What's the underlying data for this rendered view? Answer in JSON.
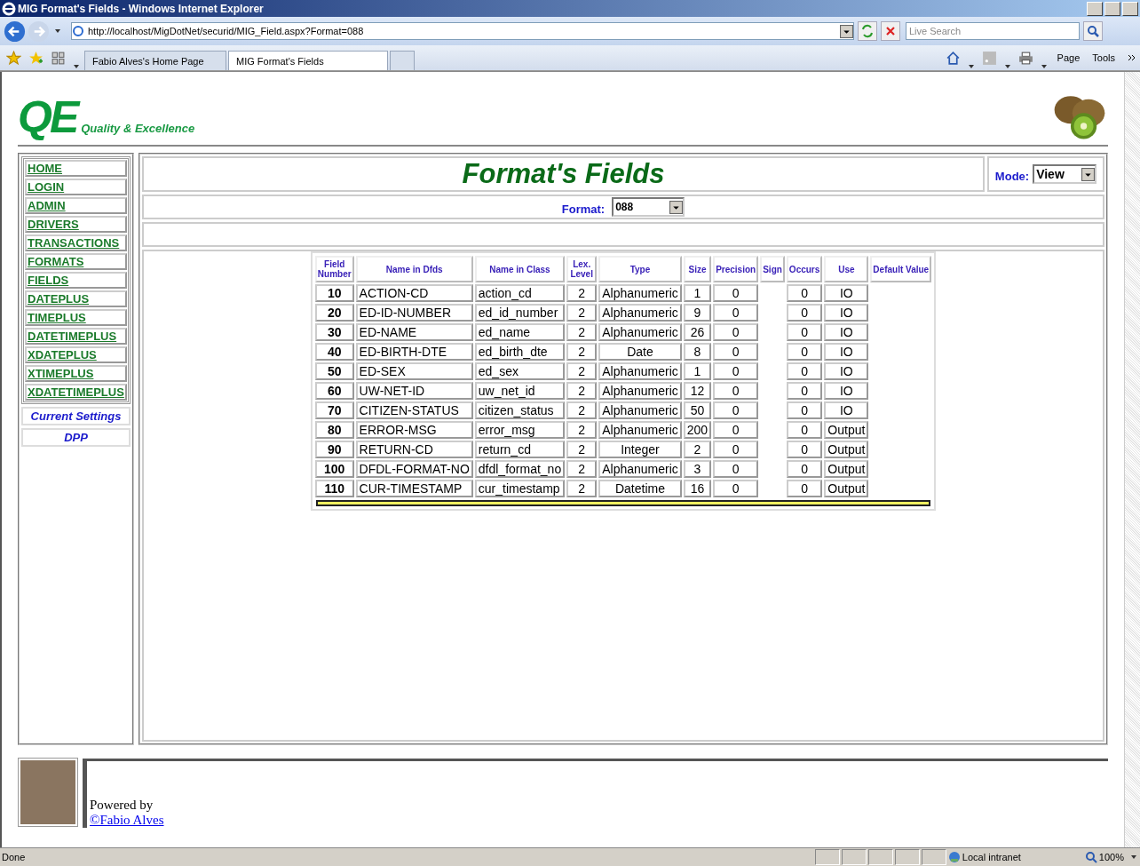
{
  "window": {
    "title": "MIG Format's Fields - Windows Internet Explorer"
  },
  "address": "http://localhost/MigDotNet/securid/MIG_Field.aspx?Format=088",
  "search": {
    "placeholder": "Live Search"
  },
  "tabs": [
    {
      "label": "Fabio Alves's Home Page",
      "selected": false
    },
    {
      "label": "MIG Format's Fields",
      "selected": true
    }
  ],
  "command_bar": [
    "Page",
    "Tools"
  ],
  "logo": {
    "mark": "QE",
    "tagline": "Quality & Excellence"
  },
  "nav": [
    "HOME",
    "LOGIN",
    "ADMIN",
    "DRIVERS",
    "TRANSACTIONS",
    "FORMATS",
    "FIELDS",
    "DATEPLUS",
    "TIMEPLUS",
    "DATETIMEPLUS",
    "XDATEPLUS",
    "XTIMEPLUS",
    "XDATETIMEPLUS"
  ],
  "side_links": [
    "Current Settings",
    "DPP"
  ],
  "heading": "Format's Fields",
  "mode": {
    "label": "Mode:",
    "value": "View"
  },
  "format": {
    "label": "Format:",
    "value": "088"
  },
  "table": {
    "columns": [
      "Field Number",
      "Name in Dfds",
      "Name in Class",
      "Lex. Level",
      "Type",
      "Size",
      "Precision",
      "Sign",
      "Occurs",
      "Use",
      "Default Value"
    ],
    "rows": [
      [
        "10",
        "ACTION-CD",
        "action_cd",
        "2",
        "Alphanumeric",
        "1",
        "0",
        "",
        "0",
        "IO"
      ],
      [
        "20",
        "ED-ID-NUMBER",
        "ed_id_number",
        "2",
        "Alphanumeric",
        "9",
        "0",
        "",
        "0",
        "IO"
      ],
      [
        "30",
        "ED-NAME",
        "ed_name",
        "2",
        "Alphanumeric",
        "26",
        "0",
        "",
        "0",
        "IO"
      ],
      [
        "40",
        "ED-BIRTH-DTE",
        "ed_birth_dte",
        "2",
        "Date",
        "8",
        "0",
        "",
        "0",
        "IO"
      ],
      [
        "50",
        "ED-SEX",
        "ed_sex",
        "2",
        "Alphanumeric",
        "1",
        "0",
        "",
        "0",
        "IO"
      ],
      [
        "60",
        "UW-NET-ID",
        "uw_net_id",
        "2",
        "Alphanumeric",
        "12",
        "0",
        "",
        "0",
        "IO"
      ],
      [
        "70",
        "CITIZEN-STATUS",
        "citizen_status",
        "2",
        "Alphanumeric",
        "50",
        "0",
        "",
        "0",
        "IO"
      ],
      [
        "80",
        "ERROR-MSG",
        "error_msg",
        "2",
        "Alphanumeric",
        "200",
        "0",
        "",
        "0",
        "Output"
      ],
      [
        "90",
        "RETURN-CD",
        "return_cd",
        "2",
        "Integer",
        "2",
        "0",
        "",
        "0",
        "Output"
      ],
      [
        "100",
        "DFDL-FORMAT-NO",
        "dfdl_format_no",
        "2",
        "Alphanumeric",
        "3",
        "0",
        "",
        "0",
        "Output"
      ],
      [
        "110",
        "CUR-TIMESTAMP",
        "cur_timestamp",
        "2",
        "Datetime",
        "16",
        "0",
        "",
        "0",
        "Output"
      ]
    ]
  },
  "footer": {
    "powered_by": "Powered by",
    "link": "©Fabio Alves"
  },
  "status_bar": {
    "text": "Done",
    "zone": "Local intranet",
    "zoom": "100%"
  }
}
